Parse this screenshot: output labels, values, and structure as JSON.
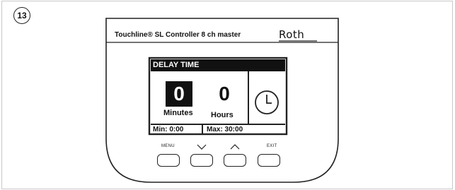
{
  "step_number": "13",
  "controller": {
    "product_name": "Touchline® SL Controller 8 ch master",
    "brand": "Roth"
  },
  "screen": {
    "title": "DELAY TIME",
    "minutes_value": "0",
    "minutes_label": "Minutes",
    "hours_value": "0",
    "hours_label": "Hours",
    "min_label": "Min: 0:00",
    "max_label": "Max: 30:00",
    "icon": "clock-icon"
  },
  "buttons": [
    {
      "label": "MENU",
      "icon": ""
    },
    {
      "label": "",
      "icon": "chevron-down-icon"
    },
    {
      "label": "",
      "icon": "chevron-up-icon"
    },
    {
      "label": "EXIT",
      "icon": ""
    }
  ]
}
